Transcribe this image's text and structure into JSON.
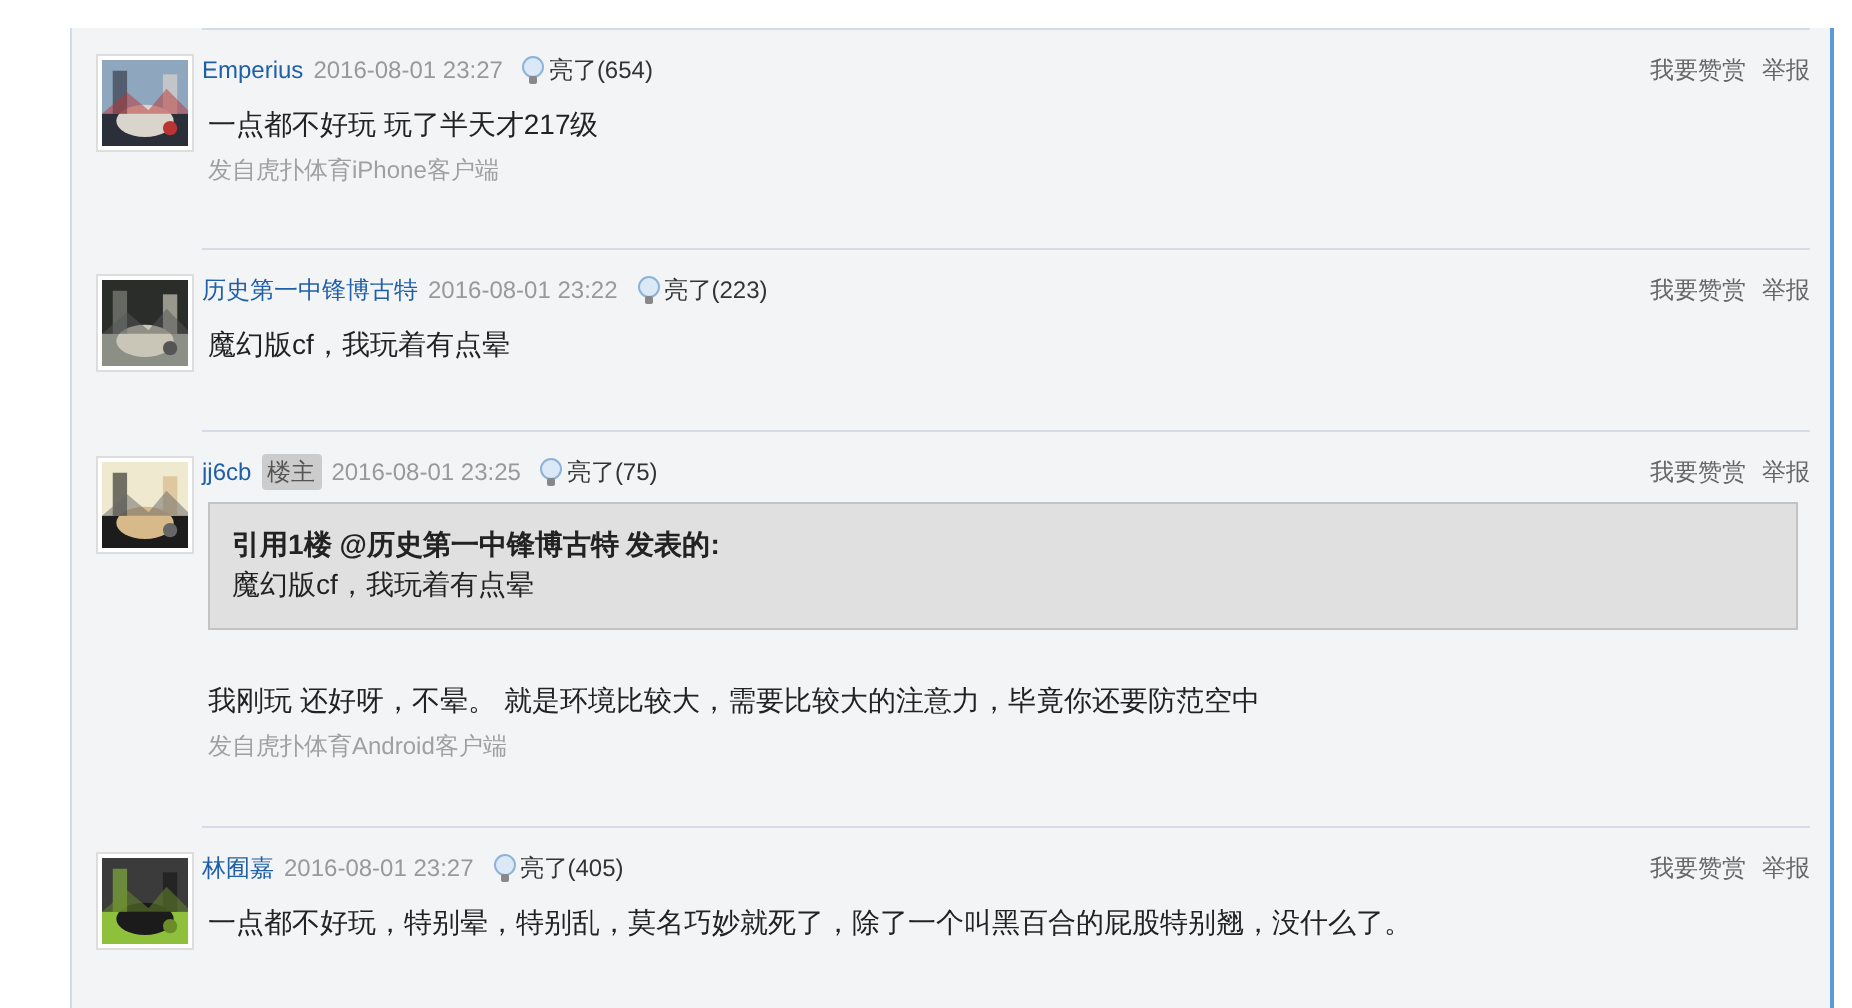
{
  "posts": [
    {
      "author": "Emperius",
      "time": "2016-08-01 23:27",
      "likes": "亮了(654)",
      "actions": [
        "我要赞赏",
        "举报"
      ],
      "body": "一点都不好玩 玩了半天才217级",
      "source": "发自虎扑体育iPhone客户端"
    },
    {
      "author": "历史第一中锋博古特",
      "time": "2016-08-01 23:22",
      "likes": "亮了(223)",
      "actions": [
        "我要赞赏",
        "举报"
      ],
      "body": "魔幻版cf，我玩着有点晕"
    },
    {
      "author": "jj6cb",
      "badge": "楼主",
      "time": "2016-08-01 23:25",
      "likes": "亮了(75)",
      "actions": [
        "我要赞赏",
        "举报"
      ],
      "quote": {
        "lead": "引用1楼 ",
        "mention": "@历史第一中锋博古特",
        "tail": " 发表的:",
        "text": "魔幻版cf，我玩着有点晕"
      },
      "body": "我刚玩 还好呀，不晕。 就是环境比较大，需要比较大的注意力，毕竟你还要防范空中",
      "source": "发自虎扑体育Android客户端"
    },
    {
      "author": "林囿嘉",
      "time": "2016-08-01 23:27",
      "likes": "亮了(405)",
      "actions": [
        "我要赞赏",
        "举报"
      ],
      "body": "一点都不好玩，特别晕，特别乱，莫名巧妙就死了，除了一个叫黑百合的屁股特别翘，没什么了。"
    }
  ]
}
